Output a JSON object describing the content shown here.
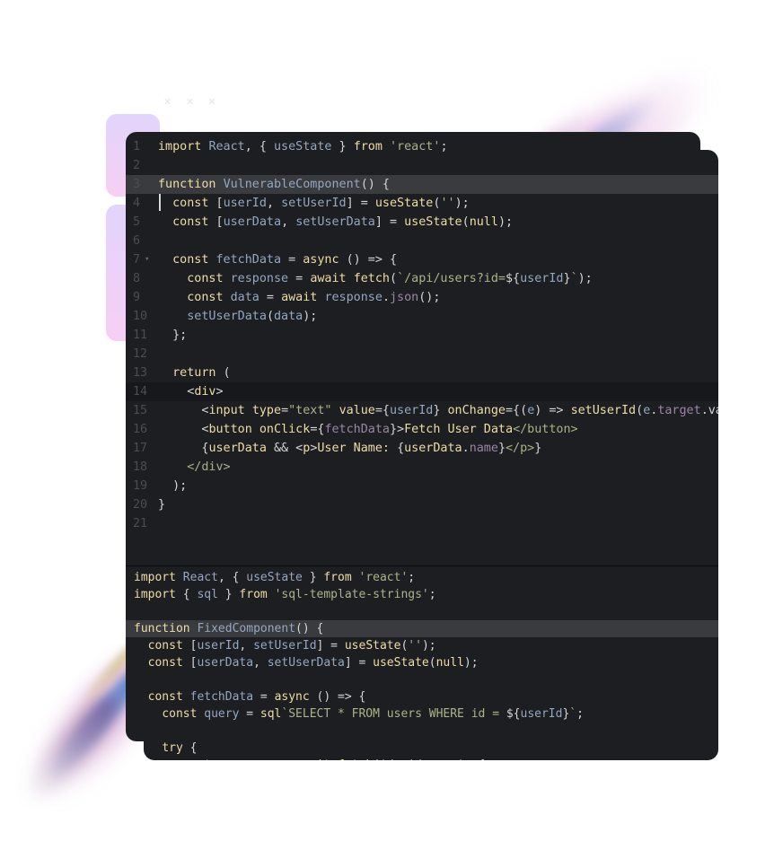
{
  "decor": {
    "xmarks_row1": "✕ ✕ ✕",
    "xmarks_row2": "✕ ✕ ✕"
  },
  "vulnerable_editor": {
    "fold_icon": "▾",
    "highlighted_lines": [
      3,
      14
    ],
    "cursor_line": 4,
    "lines": [
      {
        "n": "1",
        "tokens": [
          [
            "kw",
            "import"
          ],
          [
            "pl",
            " "
          ],
          [
            "id",
            "React"
          ],
          [
            "pl",
            ", { "
          ],
          [
            "id",
            "useState"
          ],
          [
            "pl",
            " } "
          ],
          [
            "kw",
            "from"
          ],
          [
            "pl",
            " "
          ],
          [
            "st",
            "'react'"
          ],
          [
            "pl",
            ";"
          ]
        ]
      },
      {
        "n": "2",
        "tokens": []
      },
      {
        "n": "3",
        "tokens": [
          [
            "kw",
            "function"
          ],
          [
            "pl",
            " "
          ],
          [
            "id",
            "VulnerableComponent"
          ],
          [
            "pl",
            "() {"
          ]
        ]
      },
      {
        "n": "4",
        "tokens": [
          [
            "pl",
            "  "
          ],
          [
            "kw",
            "const"
          ],
          [
            "pl",
            " ["
          ],
          [
            "id",
            "userId"
          ],
          [
            "pl",
            ", "
          ],
          [
            "id",
            "setUserId"
          ],
          [
            "pl",
            "] = "
          ],
          [
            "kw",
            "useState"
          ],
          [
            "pl",
            "("
          ],
          [
            "st",
            "''"
          ],
          [
            "pl",
            ");"
          ]
        ]
      },
      {
        "n": "5",
        "tokens": [
          [
            "pl",
            "  "
          ],
          [
            "kw",
            "const"
          ],
          [
            "pl",
            " ["
          ],
          [
            "id",
            "userData"
          ],
          [
            "pl",
            ", "
          ],
          [
            "id",
            "setUserData"
          ],
          [
            "pl",
            "] = "
          ],
          [
            "kw",
            "useState"
          ],
          [
            "pl",
            "("
          ],
          [
            "kw",
            "null"
          ],
          [
            "pl",
            ");"
          ]
        ]
      },
      {
        "n": "6",
        "tokens": []
      },
      {
        "n": "7",
        "fold": true,
        "tokens": [
          [
            "pl",
            "  "
          ],
          [
            "kw",
            "const"
          ],
          [
            "pl",
            " "
          ],
          [
            "id",
            "fetchData"
          ],
          [
            "pl",
            " = "
          ],
          [
            "kw",
            "async"
          ],
          [
            "pl",
            " () => {"
          ]
        ]
      },
      {
        "n": "8",
        "tokens": [
          [
            "pl",
            "    "
          ],
          [
            "kw",
            "const"
          ],
          [
            "pl",
            " "
          ],
          [
            "id",
            "response"
          ],
          [
            "pl",
            " = "
          ],
          [
            "kw",
            "await"
          ],
          [
            "pl",
            " "
          ],
          [
            "kw",
            "fetch"
          ],
          [
            "pl",
            "("
          ],
          [
            "st",
            "`/api/users?id="
          ],
          [
            "pl",
            "${"
          ],
          [
            "id",
            "userId"
          ],
          [
            "pl",
            "}"
          ],
          [
            "st",
            "`"
          ],
          [
            "pl",
            ");"
          ]
        ]
      },
      {
        "n": "9",
        "tokens": [
          [
            "pl",
            "    "
          ],
          [
            "kw",
            "const"
          ],
          [
            "pl",
            " "
          ],
          [
            "id",
            "data"
          ],
          [
            "pl",
            " = "
          ],
          [
            "kw",
            "await"
          ],
          [
            "pl",
            " "
          ],
          [
            "id",
            "response"
          ],
          [
            "pl",
            "."
          ],
          [
            "pr",
            "json"
          ],
          [
            "pl",
            "();"
          ]
        ]
      },
      {
        "n": "10",
        "tokens": [
          [
            "pl",
            "    "
          ],
          [
            "id",
            "setUserData"
          ],
          [
            "pl",
            "("
          ],
          [
            "id",
            "data"
          ],
          [
            "pl",
            ");"
          ]
        ]
      },
      {
        "n": "11",
        "tokens": [
          [
            "pl",
            "  };"
          ]
        ]
      },
      {
        "n": "12",
        "tokens": []
      },
      {
        "n": "13",
        "tokens": [
          [
            "pl",
            "  "
          ],
          [
            "kw",
            "return"
          ],
          [
            "pl",
            " ("
          ]
        ]
      },
      {
        "n": "14",
        "tokens": [
          [
            "pl",
            "    <"
          ],
          [
            "kw",
            "div"
          ],
          [
            "pl",
            ">"
          ]
        ]
      },
      {
        "n": "15",
        "tokens": [
          [
            "pl",
            "      <"
          ],
          [
            "kw",
            "input"
          ],
          [
            "pl",
            " "
          ],
          [
            "kw",
            "type"
          ],
          [
            "pl",
            "="
          ],
          [
            "st",
            "\"text\""
          ],
          [
            "pl",
            " "
          ],
          [
            "kw",
            "value"
          ],
          [
            "pl",
            "={"
          ],
          [
            "id",
            "userId"
          ],
          [
            "pl",
            "} "
          ],
          [
            "kw",
            "onChange"
          ],
          [
            "pl",
            "={("
          ],
          [
            "id",
            "e"
          ],
          [
            "pl",
            ") => "
          ],
          [
            "kw",
            "setUserId"
          ],
          [
            "pl",
            "("
          ],
          [
            "id",
            "e"
          ],
          [
            "pl",
            "."
          ],
          [
            "pr",
            "target"
          ],
          [
            "pl",
            ".value)} />"
          ]
        ]
      },
      {
        "n": "16",
        "tokens": [
          [
            "pl",
            "      <"
          ],
          [
            "kw",
            "button"
          ],
          [
            "pl",
            " "
          ],
          [
            "kw",
            "onClick"
          ],
          [
            "pl",
            "={"
          ],
          [
            "pr",
            "fetchData"
          ],
          [
            "pl",
            "}>"
          ],
          [
            "kw",
            "Fetch User Data"
          ],
          [
            "tg",
            "</button>"
          ]
        ]
      },
      {
        "n": "17",
        "tokens": [
          [
            "pl",
            "      {"
          ],
          [
            "kw",
            "userData"
          ],
          [
            "pl",
            " && <"
          ],
          [
            "kw",
            "p"
          ],
          [
            "pl",
            ">"
          ],
          [
            "kw",
            "User Name: "
          ],
          [
            "pl",
            "{"
          ],
          [
            "kw",
            "userData"
          ],
          [
            "pl",
            "."
          ],
          [
            "pr",
            "name"
          ],
          [
            "pl",
            "}"
          ],
          [
            "tg",
            "</p>"
          ],
          [
            "pl",
            "}"
          ]
        ]
      },
      {
        "n": "18",
        "tokens": [
          [
            "tg",
            "    </div>"
          ]
        ]
      },
      {
        "n": "19",
        "tokens": [
          [
            "pl",
            "  );"
          ]
        ]
      },
      {
        "n": "20",
        "tokens": [
          [
            "pl",
            "}"
          ]
        ]
      },
      {
        "n": "21",
        "tokens": []
      }
    ]
  },
  "fixed_editor": {
    "highlighted_line_index": 3,
    "lines": [
      {
        "tokens": [
          [
            "kw",
            "import"
          ],
          [
            "pl",
            " "
          ],
          [
            "id",
            "React"
          ],
          [
            "pl",
            ", { "
          ],
          [
            "id",
            "useState"
          ],
          [
            "pl",
            " } "
          ],
          [
            "kw",
            "from"
          ],
          [
            "pl",
            " "
          ],
          [
            "st",
            "'react'"
          ],
          [
            "pl",
            ";"
          ]
        ]
      },
      {
        "tokens": [
          [
            "kw",
            "import"
          ],
          [
            "pl",
            " { "
          ],
          [
            "id",
            "sql"
          ],
          [
            "pl",
            " } "
          ],
          [
            "kw",
            "from"
          ],
          [
            "pl",
            " "
          ],
          [
            "st",
            "'sql-template-strings'"
          ],
          [
            "pl",
            ";"
          ]
        ]
      },
      {
        "tokens": []
      },
      {
        "tokens": [
          [
            "kw",
            "function"
          ],
          [
            "pl",
            " "
          ],
          [
            "id",
            "FixedComponent"
          ],
          [
            "pl",
            "() {"
          ]
        ]
      },
      {
        "tokens": [
          [
            "pl",
            "  "
          ],
          [
            "kw",
            "const"
          ],
          [
            "pl",
            " ["
          ],
          [
            "id",
            "userId"
          ],
          [
            "pl",
            ", "
          ],
          [
            "id",
            "setUserId"
          ],
          [
            "pl",
            "] = "
          ],
          [
            "kw",
            "useState"
          ],
          [
            "pl",
            "("
          ],
          [
            "st",
            "''"
          ],
          [
            "pl",
            ");"
          ]
        ]
      },
      {
        "tokens": [
          [
            "pl",
            "  "
          ],
          [
            "kw",
            "const"
          ],
          [
            "pl",
            " ["
          ],
          [
            "id",
            "userData"
          ],
          [
            "pl",
            ", "
          ],
          [
            "id",
            "setUserData"
          ],
          [
            "pl",
            "] = "
          ],
          [
            "kw",
            "useState"
          ],
          [
            "pl",
            "("
          ],
          [
            "kw",
            "null"
          ],
          [
            "pl",
            ");"
          ]
        ]
      },
      {
        "tokens": []
      },
      {
        "tokens": [
          [
            "pl",
            "  "
          ],
          [
            "kw",
            "const"
          ],
          [
            "pl",
            " "
          ],
          [
            "id",
            "fetchData"
          ],
          [
            "pl",
            " = "
          ],
          [
            "kw",
            "async"
          ],
          [
            "pl",
            " () => {"
          ]
        ]
      },
      {
        "tokens": [
          [
            "pl",
            "    "
          ],
          [
            "kw",
            "const"
          ],
          [
            "pl",
            " "
          ],
          [
            "id",
            "query"
          ],
          [
            "pl",
            " = "
          ],
          [
            "kw",
            "sql"
          ],
          [
            "st",
            "`SELECT * FROM users WHERE id = "
          ],
          [
            "pl",
            "${"
          ],
          [
            "id",
            "userId"
          ],
          [
            "pl",
            "}"
          ],
          [
            "st",
            "`"
          ],
          [
            "pl",
            ";"
          ]
        ]
      },
      {
        "tokens": []
      },
      {
        "tokens": [
          [
            "pl",
            "    "
          ],
          [
            "kw",
            "try"
          ],
          [
            "pl",
            " {"
          ]
        ]
      },
      {
        "tokens": [
          [
            "pl",
            "      "
          ],
          [
            "kw",
            "const"
          ],
          [
            "pl",
            " "
          ],
          [
            "id",
            "response"
          ],
          [
            "pl",
            " = "
          ],
          [
            "kw",
            "await"
          ],
          [
            "pl",
            " "
          ],
          [
            "kw",
            "fetch"
          ],
          [
            "pl",
            "("
          ],
          [
            "st",
            "'/api/users'"
          ],
          [
            "pl",
            ", {"
          ]
        ]
      }
    ]
  }
}
